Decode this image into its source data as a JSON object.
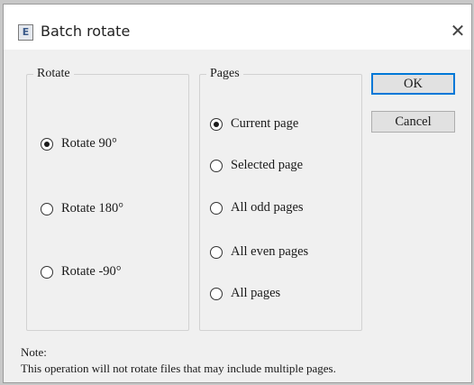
{
  "window": {
    "title": "Batch rotate",
    "icon": "app-document-icon",
    "close_glyph": "✕"
  },
  "rotate_group": {
    "label": "Rotate",
    "options": [
      {
        "label": "Rotate 90°",
        "checked": true
      },
      {
        "label": "Rotate 180°",
        "checked": false
      },
      {
        "label": "Rotate -90°",
        "checked": false
      }
    ]
  },
  "pages_group": {
    "label": "Pages",
    "options": [
      {
        "label": "Current page",
        "checked": true
      },
      {
        "label": "Selected page",
        "checked": false
      },
      {
        "label": "All odd pages",
        "checked": false
      },
      {
        "label": "All even pages",
        "checked": false
      },
      {
        "label": "All pages",
        "checked": false
      }
    ]
  },
  "buttons": {
    "ok": "OK",
    "cancel": "Cancel"
  },
  "note": {
    "label": "Note:",
    "text": "This operation will not rotate files that may include multiple pages."
  },
  "colors": {
    "accent": "#0078d7",
    "dialog_bg": "#f0f0f0",
    "titlebar_bg": "#ffffff"
  }
}
